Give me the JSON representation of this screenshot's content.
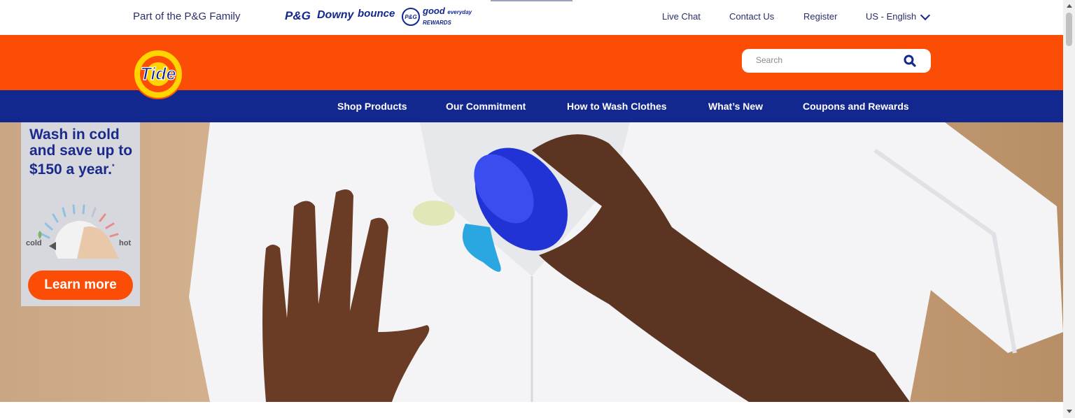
{
  "topbar": {
    "family_text": "Part of the P&G Family",
    "brands": [
      "P&G",
      "Downy",
      "bounce",
      "P&G good everyday REWARDS"
    ],
    "brand_good_badge": "P&G",
    "brand_good_text": "good",
    "brand_good_sub": "everyday",
    "brand_good_rewards": "REWARDS",
    "links": {
      "live_chat": "Live Chat",
      "contact_us": "Contact Us",
      "register": "Register",
      "language": "US - English"
    }
  },
  "header": {
    "logo_text": "Tide",
    "search": {
      "placeholder": "Search"
    }
  },
  "nav": {
    "items": [
      "Shop Products",
      "Our Commitment",
      "How to Wash Clothes",
      "What’s New",
      "Coupons and Rewards"
    ]
  },
  "promo": {
    "headline": "Wash in cold and save up to $150 a year.",
    "footnote_mark": "*",
    "cold_label": "cold",
    "hot_label": "hot",
    "cta": "Learn more"
  },
  "colors": {
    "orange": "#fb4d05",
    "navy": "#13288e",
    "logo_yellow": "#ffd400"
  }
}
